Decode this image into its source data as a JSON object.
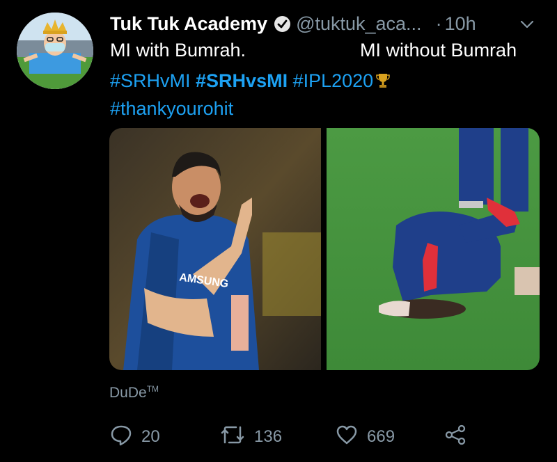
{
  "tweet": {
    "author_name": "Tuk Tuk Academy",
    "handle": "@tuktuk_aca...",
    "dot": "·",
    "time": "10h",
    "text_left": "MI with Bumrah.",
    "text_right": "MI without Bumrah",
    "hashtags": [
      "#SRHvMI",
      "#SRHvsMI",
      "#IPL2020"
    ],
    "hashtag2": "#thankyourohit",
    "source_label": "DuDe",
    "source_mark": "TM"
  },
  "actions": {
    "replies": "20",
    "retweets": "136",
    "likes": "669"
  },
  "colors": {
    "background": "#000000",
    "link": "#1da1f2",
    "muted": "#8899a6"
  },
  "icons": {
    "verified": "verified-badge-icon",
    "more": "chevron-down-icon",
    "reply": "reply-icon",
    "retweet": "retweet-icon",
    "like": "heart-icon",
    "share": "share-icon",
    "trophy": "trophy-icon"
  }
}
